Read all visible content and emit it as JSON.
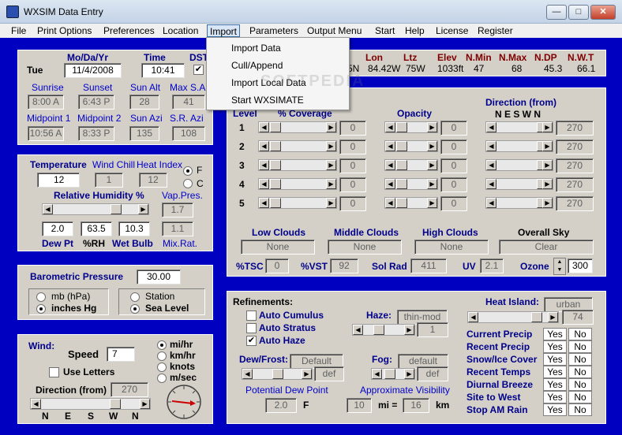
{
  "window": {
    "title": "WXSIM Data Entry",
    "minimize": "—",
    "maximize": "□",
    "close": "✕"
  },
  "menu": [
    "File",
    "Print Options",
    "Preferences",
    "Location",
    "Import",
    "Parameters",
    "Output Menu",
    "Start",
    "Help",
    "License",
    "Register"
  ],
  "import_menu": [
    "Import Data",
    "Cull/Append",
    "Import Local Data",
    "Start WXSIMATE"
  ],
  "watermark": "SOFTPEDIA",
  "date_time": {
    "day": "Tue",
    "date_label": "Mo/Da/Yr",
    "date": "11/4/2008",
    "time_label": "Time",
    "time": "10:41",
    "dst_label": "DST",
    "dst_check": "✔",
    "sunrise_label": "Sunrise",
    "sunrise": "8:00 A",
    "sunset_label": "Sunset",
    "sunset": "6:43 P",
    "sunalt_label": "Sun Alt",
    "sunalt": "28",
    "maxsunalt_label": "Max S.Alt",
    "maxsunalt": "41",
    "mid1_label": "Midpoint 1",
    "mid1": "10:56 A",
    "mid2_label": "Midpoint 2",
    "mid2": "8:33 P",
    "sunazi_label": "Sun Azi",
    "sunazi": "135",
    "srazi_label": "S.R. Azi",
    "srazi": "108"
  },
  "location": {
    "lat_value": "5N",
    "lon_label": "Lon",
    "lon": "84.42W",
    "ltz_label": "Ltz",
    "ltz": "75W",
    "elev_label": "Elev",
    "elev": "1033ft",
    "nmin_label": "N.Min",
    "nmin": "47",
    "nmax_label": "N.Max",
    "nmax": "68",
    "ndp_label": "N.DP",
    "ndp": "45.3",
    "nwt_label": "N.W.T",
    "nwt": "66.1"
  },
  "temp": {
    "temp_label": "Temperature",
    "temp": "12",
    "wc_label": "Wind Chill",
    "wc": "1",
    "hi_label": "Heat Index",
    "hi": "12",
    "f": "F",
    "c": "C",
    "rh_label": "Relative Humidity %",
    "vp_label": "Vap.Pres.",
    "vp": "1.7",
    "dewpt": "2.0",
    "rh": "63.5",
    "wetbulb": "10.3",
    "mixrat": "1.1",
    "dewpt_label": "Dew Pt",
    "rh_short": "%RH",
    "wb_label": "Wet Bulb",
    "mr_label": "Mix.Rat."
  },
  "baro": {
    "label": "Barometric Pressure",
    "value": "30.00",
    "mb": "mb (hPa)",
    "inhg": "inches Hg",
    "station": "Station",
    "sealevel": "Sea Level"
  },
  "wind": {
    "label": "Wind:",
    "speed_label": "Speed",
    "speed": "7",
    "letters": "Use Letters",
    "dir_label": "Direction (from)",
    "dir": "270",
    "mph": "mi/hr",
    "kph": "km/hr",
    "knots": "knots",
    "mps": "m/sec",
    "scale": [
      "N",
      "E",
      "S",
      "W",
      "N"
    ]
  },
  "clouds": {
    "level_label": "Level",
    "cov_label": "% Coverage",
    "opacity_label": "Opacity",
    "dir_label": "Direction (from)",
    "dir_letters": "N E S W N",
    "levels": [
      {
        "n": "1",
        "cov": "0",
        "op": "0",
        "dir": "270"
      },
      {
        "n": "2",
        "cov": "0",
        "op": "0",
        "dir": "270"
      },
      {
        "n": "3",
        "cov": "0",
        "op": "0",
        "dir": "270"
      },
      {
        "n": "4",
        "cov": "0",
        "op": "0",
        "dir": "270"
      },
      {
        "n": "5",
        "cov": "0",
        "op": "0",
        "dir": "270"
      }
    ],
    "low_label": "Low Clouds",
    "low": "None",
    "mid_label": "Middle Clouds",
    "mid": "None",
    "high_label": "High Clouds",
    "high": "None",
    "sky_label": "Overall Sky",
    "sky": "Clear",
    "tsc_label": "%TSC",
    "tsc": "0",
    "vst_label": "%VST",
    "vst": "92",
    "solrad_label": "Sol Rad",
    "solrad": "411",
    "uv_label": "UV",
    "uv": "2.1",
    "ozone_label": "Ozone",
    "ozone": "300"
  },
  "refine": {
    "label": "Refinements:",
    "cumulus": "Auto Cumulus",
    "stratus": "Auto Stratus",
    "haze": "Auto Haze",
    "haze_check": "✔",
    "haze_label": "Haze:",
    "haze_val": "thin-mod",
    "haze_num": "1",
    "dewfrost_label": "Dew/Frost:",
    "dewfrost_val": "Default",
    "dewfrost_def": "def",
    "fog_label": "Fog:",
    "fog_val": "default",
    "fog_def": "def",
    "pdp_label": "Potential Dew Point",
    "pdp": "2.0",
    "pdp_unit": "F",
    "vis_label": "Approximate Visibility",
    "vis_mi": "10",
    "mi": "mi =",
    "vis_km": "16",
    "km": "km",
    "heat_label": "Heat Island:",
    "heat_val": "urban",
    "heat_num": "74",
    "flags": [
      {
        "label": "Current Precip",
        "yes": "Yes",
        "no": "No"
      },
      {
        "label": "Recent Precip",
        "yes": "Yes",
        "no": "No"
      },
      {
        "label": "Snow/Ice Cover",
        "yes": "Yes",
        "no": "No"
      },
      {
        "label": "Recent Temps",
        "yes": "Yes",
        "no": "No"
      },
      {
        "label": "Diurnal Breeze",
        "yes": "Yes",
        "no": "No"
      },
      {
        "label": "Site to West",
        "yes": "Yes",
        "no": "No"
      },
      {
        "label": "Stop AM Rain",
        "yes": "Yes",
        "no": "No"
      }
    ]
  }
}
